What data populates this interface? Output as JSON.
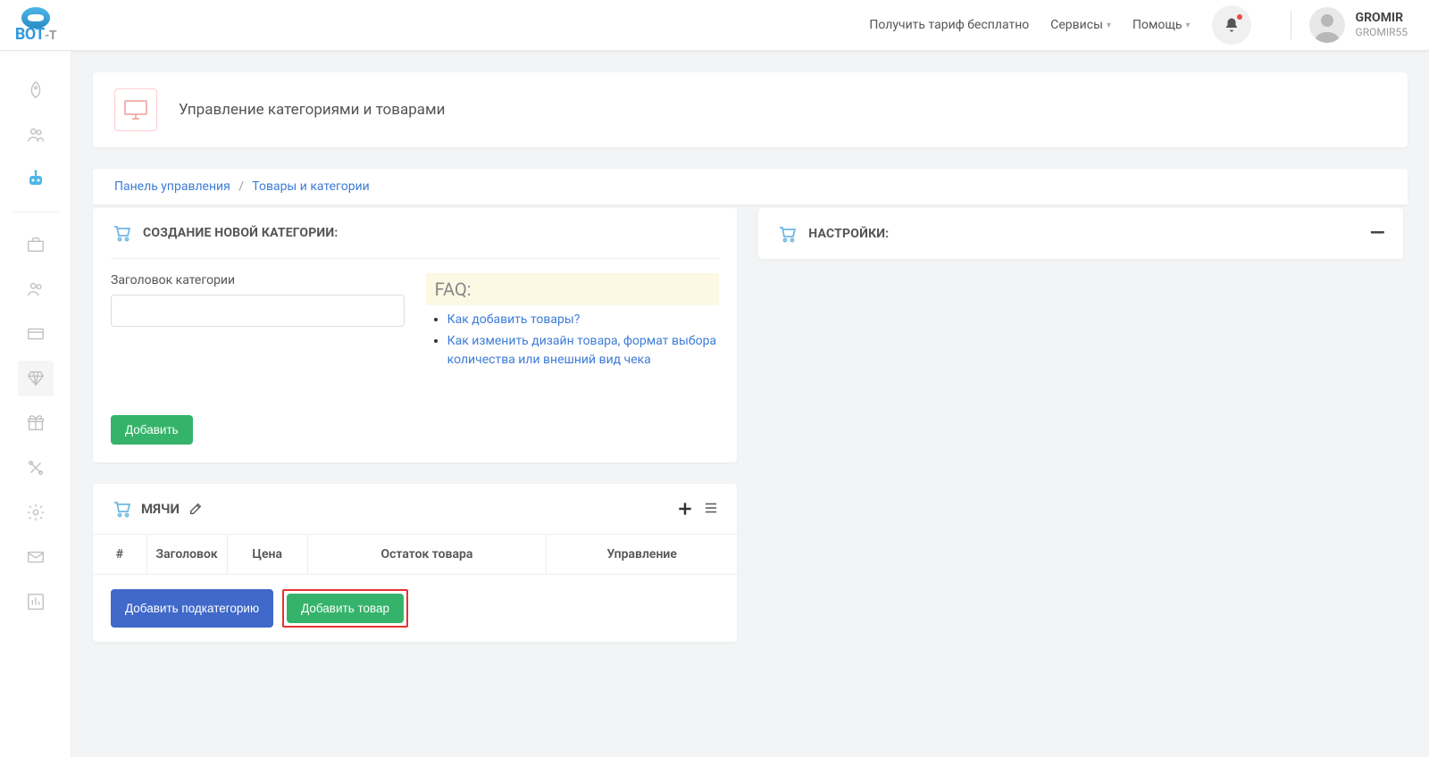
{
  "logo": {
    "text": "BOT",
    "suffix": "-T"
  },
  "header": {
    "links": {
      "tariff": "Получить тариф бесплатно",
      "services": "Сервисы",
      "help": "Помощь"
    },
    "user": {
      "name": "GROMIR",
      "sub": "GROMIR55"
    }
  },
  "sidebar_items": [
    {
      "name": "rocket",
      "active": false,
      "interactable": true
    },
    {
      "name": "users",
      "active": false,
      "interactable": true
    },
    {
      "name": "bot",
      "active": true,
      "interactable": true
    },
    {
      "name": "divider",
      "active": false,
      "interactable": false
    },
    {
      "name": "briefcase",
      "active": false,
      "interactable": true
    },
    {
      "name": "people",
      "active": false,
      "interactable": true
    },
    {
      "name": "card",
      "active": false,
      "interactable": true
    },
    {
      "name": "diamond",
      "active": false,
      "interactable": true
    },
    {
      "name": "gift",
      "active": false,
      "interactable": true
    },
    {
      "name": "tools",
      "active": false,
      "interactable": true
    },
    {
      "name": "gear",
      "active": false,
      "interactable": true
    },
    {
      "name": "mail",
      "active": false,
      "interactable": true
    },
    {
      "name": "chart",
      "active": false,
      "interactable": true
    }
  ],
  "page": {
    "title": "Управление категориями и товарами"
  },
  "breadcrumb": {
    "home": "Панель управления",
    "current": "Товары и категории"
  },
  "create_category": {
    "title": "СОЗДАНИЕ НОВОЙ КАТЕГОРИИ:",
    "label": "Заголовок категории",
    "button": "Добавить",
    "faq_title": "FAQ:",
    "faq": [
      "Как добавить товары?",
      "Как изменить дизайн товара, формат выбора количества или внешний вид чека"
    ]
  },
  "category": {
    "title": "МЯЧИ",
    "columns": {
      "num": "#",
      "title": "Заголовок",
      "price": "Цена",
      "stock": "Остаток товара",
      "manage": "Управление"
    },
    "btn_subcat": "Добавить подкатегорию",
    "btn_product": "Добавить товар"
  },
  "settings": {
    "title": "НАСТРОЙКИ:"
  }
}
